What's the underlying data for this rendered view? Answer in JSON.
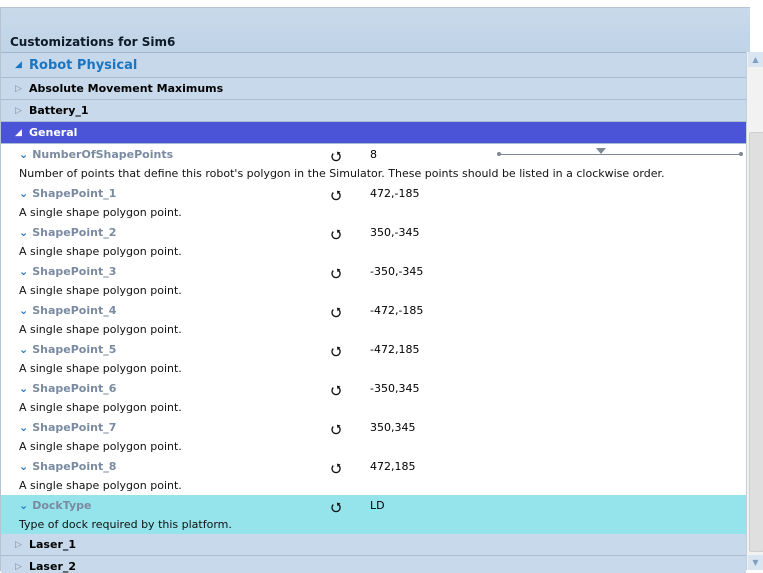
{
  "header": {
    "title": "Customizations for Sim6"
  },
  "root_section": {
    "label": "Robot Physical"
  },
  "groups_top": [
    {
      "label": "Absolute Movement Maximums"
    },
    {
      "label": "Battery_1"
    }
  ],
  "active_group": {
    "label": "General"
  },
  "properties": [
    {
      "name": "NumberOfShapePoints",
      "value": "8",
      "desc": "Number of points that define this robot's polygon in the Simulator. These points should be listed in a clockwise order."
    },
    {
      "name": "ShapePoint_1",
      "value": "472,-185",
      "desc": "A single shape polygon point."
    },
    {
      "name": "ShapePoint_2",
      "value": "350,-345",
      "desc": "A single shape polygon point."
    },
    {
      "name": "ShapePoint_3",
      "value": "-350,-345",
      "desc": "A single shape polygon point."
    },
    {
      "name": "ShapePoint_4",
      "value": "-472,-185",
      "desc": "A single shape polygon point."
    },
    {
      "name": "ShapePoint_5",
      "value": "-472,185",
      "desc": "A single shape polygon point."
    },
    {
      "name": "ShapePoint_6",
      "value": "-350,345",
      "desc": "A single shape polygon point."
    },
    {
      "name": "ShapePoint_7",
      "value": "350,345",
      "desc": "A single shape polygon point."
    },
    {
      "name": "ShapePoint_8",
      "value": "472,185",
      "desc": "A single shape polygon point."
    },
    {
      "name": "DockType",
      "value": "LD",
      "desc": "Type of dock required by this platform."
    }
  ],
  "groups_bottom": [
    {
      "label": "Laser_1"
    },
    {
      "label": "Laser_2"
    }
  ],
  "icons": {
    "reset": "reset-icon",
    "expand": "chevron-down-icon",
    "collapsed": "triangle-right-icon",
    "expanded": "triangle-down-icon"
  },
  "colors": {
    "active_group": "#4b54d6",
    "highlight_row": "#95e4ec",
    "link_blue": "#1b75c1"
  }
}
